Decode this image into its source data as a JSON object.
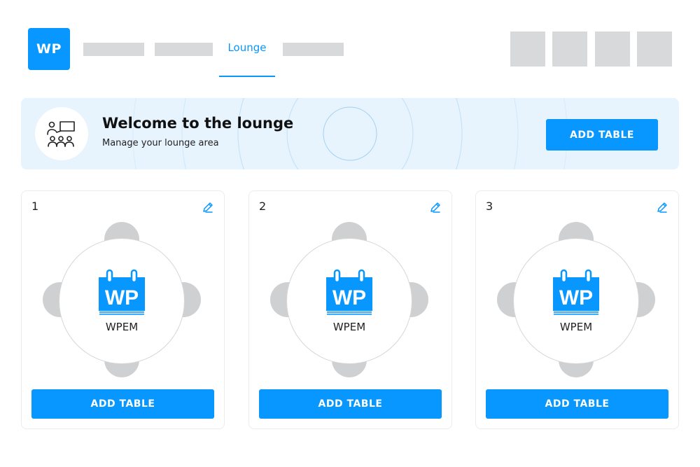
{
  "header": {
    "logo_text": "WP",
    "active_tab": "Lounge"
  },
  "banner": {
    "title": "Welcome to the lounge",
    "subtitle": "Manage your lounge area",
    "add_button": "ADD TABLE",
    "icon": "meeting-people-icon"
  },
  "tables": [
    {
      "number": "1",
      "name": "WPEM",
      "button": "ADD TABLE"
    },
    {
      "number": "2",
      "name": "WPEM",
      "button": "ADD TABLE"
    },
    {
      "number": "3",
      "name": "WPEM",
      "button": "ADD TABLE"
    }
  ],
  "table_logo_text": "WP",
  "colors": {
    "accent": "#0797ff",
    "banner_bg": "#e7f3fd",
    "placeholder": "#d8d9db",
    "seat": "#cfd0d2"
  }
}
